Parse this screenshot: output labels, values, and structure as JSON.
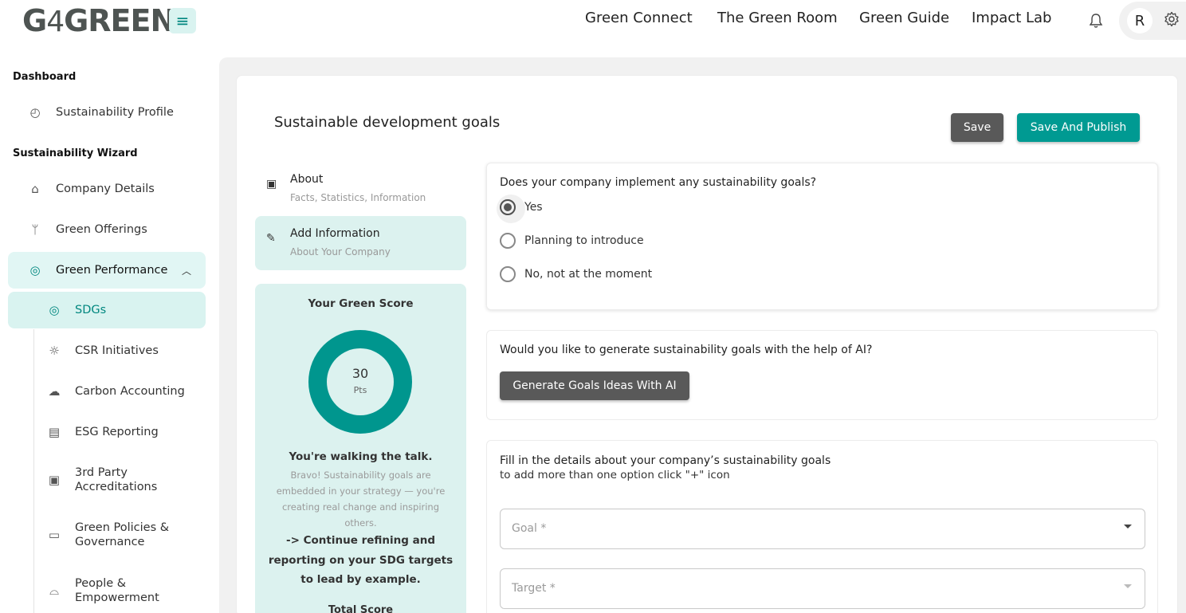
{
  "header": {
    "logo": {
      "part1": "G",
      "part2": "4",
      "part3": "GREEN"
    },
    "nav": [
      {
        "label": "Green Connect"
      },
      {
        "label": "The Green Room"
      },
      {
        "label": "Green Guide"
      },
      {
        "label": "Impact Lab"
      }
    ],
    "avatar_initial": "R"
  },
  "sidebar": {
    "section_dashboard": "Dashboard",
    "sustainability_profile": "Sustainability Profile",
    "section_wizard": "Sustainability Wizard",
    "company_details": "Company Details",
    "green_offerings": "Green Offerings",
    "green_performance": "Green Performance",
    "sub_items": [
      {
        "label": "SDGs"
      },
      {
        "label": "CSR Initiatives"
      },
      {
        "label": "Carbon Accounting"
      },
      {
        "label": "ESG Reporting"
      },
      {
        "label": "3rd Party Accreditations"
      },
      {
        "label": "Green Policies & Governance"
      },
      {
        "label": "People & Empowerment"
      }
    ]
  },
  "main": {
    "title": "Sustainable development goals",
    "save_label": "Save",
    "publish_label": "Save And Publish",
    "steps": [
      {
        "title": "About",
        "subtitle": "Facts, Statistics, Information"
      },
      {
        "title": "Add Information",
        "subtitle": "About Your Company"
      }
    ],
    "score": {
      "title": "Your Green Score",
      "value": "30",
      "unit": "Pts",
      "headline": "You're walking the talk.",
      "body": "Bravo! Sustainability goals are embedded in your strategy — you're creating real change and inspiring others.",
      "cta": "-> Continue refining and reporting on your SDG targets to lead by example.",
      "total_label": "Total Score"
    },
    "q1": {
      "question": "Does your company implement any sustainability goals?",
      "options": [
        {
          "label": "Yes"
        },
        {
          "label": "Planning to introduce"
        },
        {
          "label": "No, not at the moment"
        }
      ],
      "selected": "Yes"
    },
    "q2": {
      "question": "Would you like to generate sustainability goals with the help of AI?",
      "button": "Generate Goals Ideas With AI"
    },
    "q3": {
      "title": "Fill in the details about your company’s sustainability goals",
      "subtitle": "to add more than one option click \"+\" icon",
      "goal_placeholder": "Goal *",
      "target_placeholder": "Target *"
    }
  }
}
